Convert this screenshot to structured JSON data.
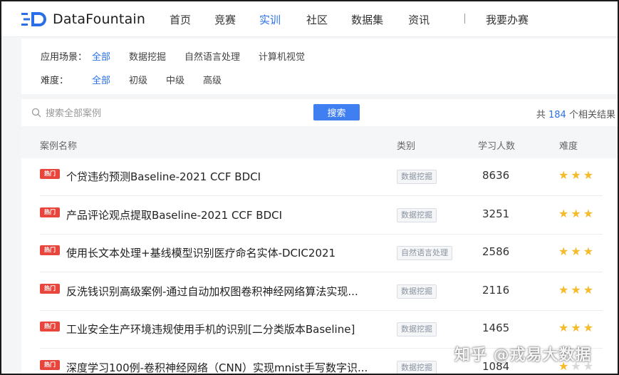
{
  "header": {
    "brand": "DataFountain",
    "nav": [
      "首页",
      "竞赛",
      "实训",
      "社区",
      "数据集",
      "资讯"
    ],
    "active_nav_index": 2,
    "extra": "我要办赛",
    "accent": "#2a6fe8"
  },
  "filters": {
    "scene_label": "应用场景：",
    "scene_options": [
      "全部",
      "数据挖掘",
      "自然语言处理",
      "计算机视觉"
    ],
    "level_label": "难度：",
    "level_options": [
      "全部",
      "初级",
      "中级",
      "高级"
    ],
    "selected_index": 0
  },
  "search": {
    "placeholder": "搜索全部案例",
    "button": "搜索",
    "result_prefix": "共",
    "result_count": "184",
    "result_suffix": "个相关结果"
  },
  "table": {
    "headers": [
      "案例名称",
      "类别",
      "学习人数",
      "难度"
    ],
    "hot_badge": "热门",
    "rows": [
      {
        "title": "个贷违约预测Baseline-2021 CCF BDCI",
        "category": "数据挖掘",
        "learners": "8636",
        "stars": 3
      },
      {
        "title": "产品评论观点提取Baseline-2021 CCF BDCI",
        "category": "数据挖掘",
        "learners": "3251",
        "stars": 3
      },
      {
        "title": "使用长文本处理+基线模型识别医疗命名实体-DCIC2021",
        "category": "自然语言处理",
        "learners": "2586",
        "stars": 3
      },
      {
        "title": "反洗钱识别高级案例-通过自动加权图卷积神经网络算法实现...",
        "category": "数据挖掘",
        "learners": "2116",
        "stars": 3
      },
      {
        "title": "工业安全生产环境违规使用手机的识别[二分类版本Baseline]",
        "category": "数据挖掘",
        "learners": "1465",
        "stars": 3
      },
      {
        "title": "深度学习100例-卷积神经网络（CNN）实现mnist手写数字识...",
        "category": "数据挖掘",
        "learners": "1084",
        "stars": 1
      }
    ]
  },
  "watermark": "知乎 @戎易大数据"
}
